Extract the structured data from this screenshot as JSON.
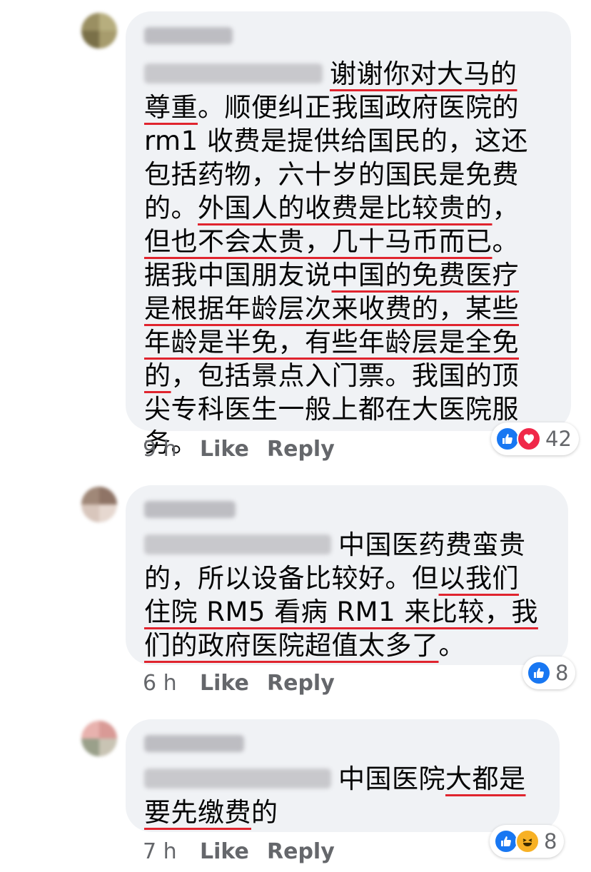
{
  "comments": [
    {
      "mention_color": "#c8c8cc",
      "body_lines": [
        [
          {
            "t": "谢谢你对大马的",
            "u": true
          }
        ],
        [
          {
            "t": "尊重",
            "u": true
          },
          {
            "t": "。顺便纠正我国政府医院的",
            "u": false
          }
        ],
        [
          {
            "t": "rm1 收费是提供给国民的，这还",
            "u": false
          }
        ],
        [
          {
            "t": "包括药物，六十岁的国民是免费",
            "u": false
          }
        ],
        [
          {
            "t": "的。",
            "u": false
          },
          {
            "t": "外国人的收费是比较贵的",
            "u": true
          },
          {
            "t": "，",
            "u": false
          }
        ],
        [
          {
            "t": "但也不会太贵，几十马币而已",
            "u": true
          },
          {
            "t": "。",
            "u": false
          }
        ],
        [
          {
            "t": "据我中国朋友说",
            "u": false
          },
          {
            "t": "中国的免费医疗",
            "u": true
          }
        ],
        [
          {
            "t": "是根据年龄层次来收费的，某些",
            "u": true
          }
        ],
        [
          {
            "t": "年龄是半免，有些年龄层是全免",
            "u": true
          }
        ],
        [
          {
            "t": "的",
            "u": true
          },
          {
            "t": "，包括景点入门票。我国的顶",
            "u": false
          }
        ],
        [
          {
            "t": "尖专科医生一般上都在大医院服",
            "u": false
          }
        ],
        [
          {
            "t": "务。",
            "u": false
          }
        ]
      ],
      "time": "9 h",
      "like_label": "Like",
      "reply_label": "Reply",
      "reactions": [
        "like-icon",
        "love-icon"
      ],
      "reaction_count": "42"
    },
    {
      "mention_color": "#c8c8cc",
      "body_lines": [
        [
          {
            "t": "中国医药费蛮贵",
            "u": false
          }
        ],
        [
          {
            "t": "的，所以设备比较好。但",
            "u": false
          },
          {
            "t": "以我们",
            "u": true
          }
        ],
        [
          {
            "t": "住院 RM5 看病 RM1 来比较，我",
            "u": true
          }
        ],
        [
          {
            "t": "们的政府医院超值太多了",
            "u": true
          },
          {
            "t": "。",
            "u": false
          }
        ]
      ],
      "time": "6 h",
      "like_label": "Like",
      "reply_label": "Reply",
      "reactions": [
        "like-icon"
      ],
      "reaction_count": "8"
    },
    {
      "mention_color": "#c8c8cc",
      "body_lines": [
        [
          {
            "t": "中国医院",
            "u": false
          },
          {
            "t": "大都是",
            "u": true
          }
        ],
        [
          {
            "t": "要先缴费",
            "u": true
          },
          {
            "t": "的",
            "u": false
          }
        ]
      ],
      "time": "7 h",
      "like_label": "Like",
      "reply_label": "Reply",
      "reactions": [
        "like-icon",
        "haha-icon"
      ],
      "reaction_count": "8"
    }
  ]
}
